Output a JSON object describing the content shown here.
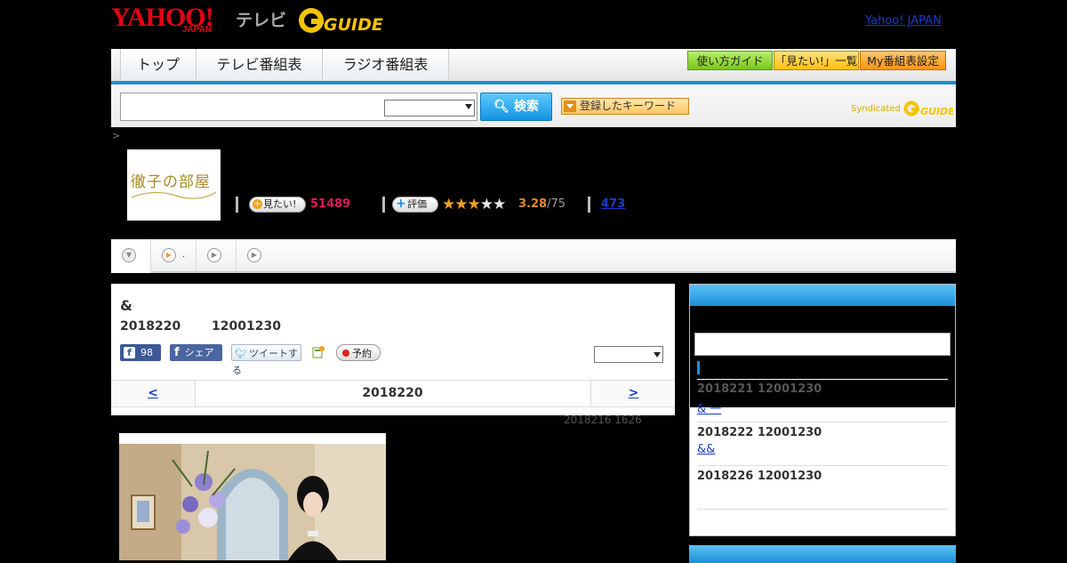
{
  "header": {
    "logo_yahoo": "YAHOO!",
    "logo_japan": "JAPAN",
    "logo_tv": "テレビ",
    "logo_gguide": "G-GUIDE",
    "yahoo_japan_link": "Yahoo! JAPAN"
  },
  "nav": {
    "tabs": [
      "トップ",
      "テレビ番組表",
      "ラジオ番組表"
    ],
    "guide_buttons": [
      "使い方ガイド",
      "「見たい!」一覧",
      "My番組表設定"
    ]
  },
  "search": {
    "button_label": "検索",
    "keyword_button_label": "登録したキーワード",
    "syndicated": "Syndicated"
  },
  "breadcrumb": ">",
  "program": {
    "thumb_title": "徹子の部屋",
    "mitai_label": "見たい!",
    "mitai_count": "51489",
    "rate_label": "評価",
    "rating_value": "3.28",
    "rating_max": "/75",
    "rating_stars_filled": 3,
    "review_count": "473"
  },
  "main": {
    "title": "&",
    "air_date": "2018220",
    "air_time": "12001230",
    "fb_like_count": "98",
    "fb_share_label": "シェア",
    "tweet_label": "ツイートする",
    "reserve_label": "予約",
    "prev_label": "<",
    "next_label": ">",
    "nav_date": "2018220",
    "updated": "2018216  1626"
  },
  "sidebar": {
    "items": [
      {
        "date_time": "2018221  12001230",
        "link": "& 一"
      },
      {
        "date_time": "2018222  12001230",
        "link": "&&"
      },
      {
        "date_time": "2018226  12001230",
        "link": ""
      }
    ]
  },
  "colors": {
    "accent_blue": "#1c8fd6",
    "mitai_pink": "#e0195a",
    "rating_orange": "#e58a2e",
    "guide_green": "#8bd12a",
    "guide_yellow": "#ffc81e",
    "guide_orange": "#ff9c1e"
  }
}
